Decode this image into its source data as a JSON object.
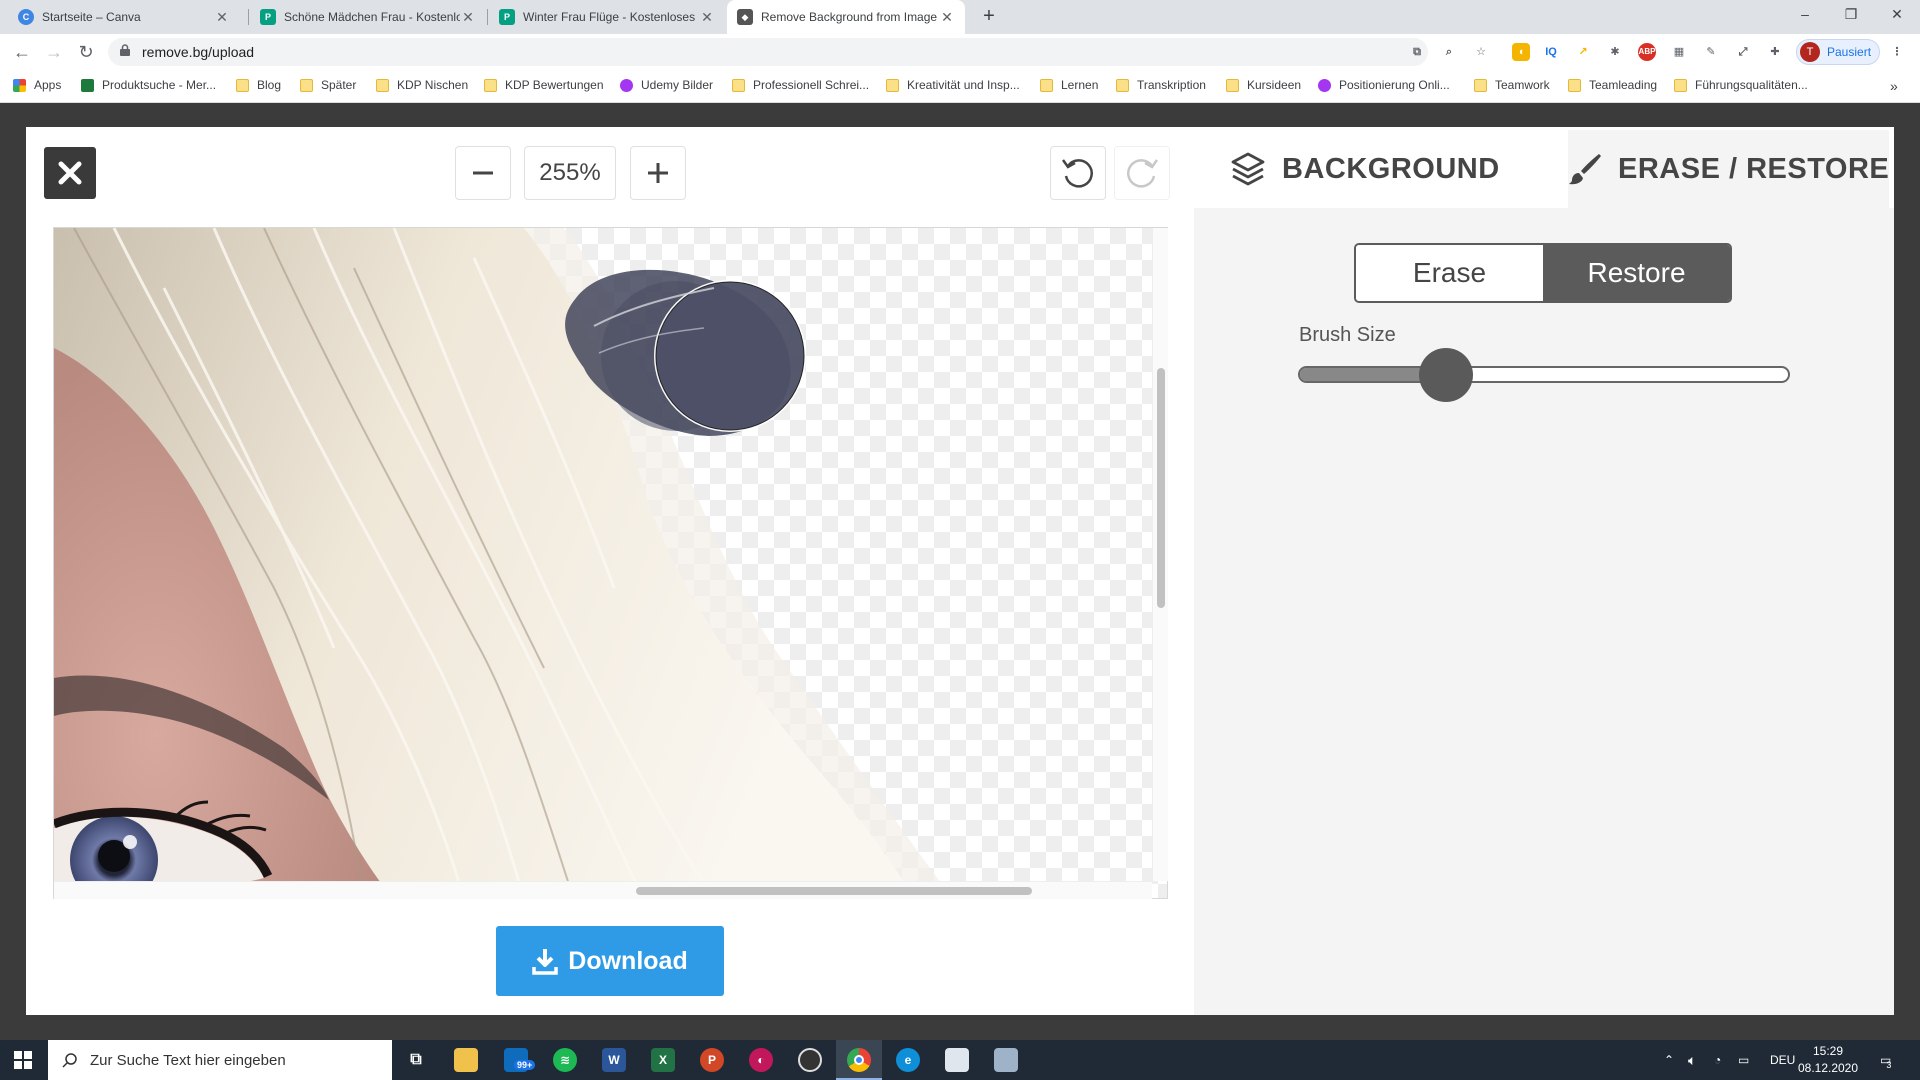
{
  "browser": {
    "tabs": [
      {
        "title": "Startseite – Canva",
        "icon": "canva-icon",
        "active": false
      },
      {
        "title": "Schöne Mädchen Frau - Kostenlo",
        "icon": "pexels-icon",
        "active": false
      },
      {
        "title": "Winter Frau Flüge - Kostenloses",
        "icon": "pexels-icon",
        "active": false
      },
      {
        "title": "Remove Background from Image",
        "icon": "removebg-icon",
        "active": true
      }
    ],
    "url": "remove.bg/upload",
    "profile_initial": "T",
    "profile_label": "Pausiert"
  },
  "bookmarks": [
    {
      "label": "Apps",
      "icon": "apps-grid-icon"
    },
    {
      "label": "Produktsuche - Mer...",
      "icon": "site-icon"
    },
    {
      "label": "Blog",
      "icon": "folder-icon"
    },
    {
      "label": "Später",
      "icon": "folder-icon"
    },
    {
      "label": "KDP Nischen",
      "icon": "folder-icon"
    },
    {
      "label": "KDP Bewertungen",
      "icon": "folder-icon"
    },
    {
      "label": "Udemy Bilder",
      "icon": "udemy-icon"
    },
    {
      "label": "Professionell Schrei...",
      "icon": "folder-icon"
    },
    {
      "label": "Kreativität und Insp...",
      "icon": "folder-icon"
    },
    {
      "label": "Lernen",
      "icon": "folder-icon"
    },
    {
      "label": "Transkription",
      "icon": "folder-icon"
    },
    {
      "label": "Kursideen",
      "icon": "folder-icon"
    },
    {
      "label": "Positionierung Onli...",
      "icon": "udemy-icon"
    },
    {
      "label": "Teamwork",
      "icon": "folder-icon"
    },
    {
      "label": "Teamleading",
      "icon": "folder-icon"
    },
    {
      "label": "Führungsqualitäten...",
      "icon": "folder-icon"
    }
  ],
  "editor": {
    "zoom": "255%",
    "tabs": {
      "background": "BACKGROUND",
      "erase_restore": "ERASE / RESTORE"
    },
    "mode": {
      "erase": "Erase",
      "restore": "Restore",
      "selected": "Restore"
    },
    "brush_size_label": "Brush Size",
    "brush_size_fraction": 0.3,
    "download_label": "Download"
  },
  "taskbar": {
    "search_placeholder": "Zur Suche Text hier eingeben",
    "mail_badge": "99+",
    "language": "DEU",
    "time": "15:29",
    "date": "08.12.2020",
    "notification_count": "3"
  },
  "colors": {
    "accent": "#2f9ae6",
    "dark": "#5b5b5b"
  }
}
